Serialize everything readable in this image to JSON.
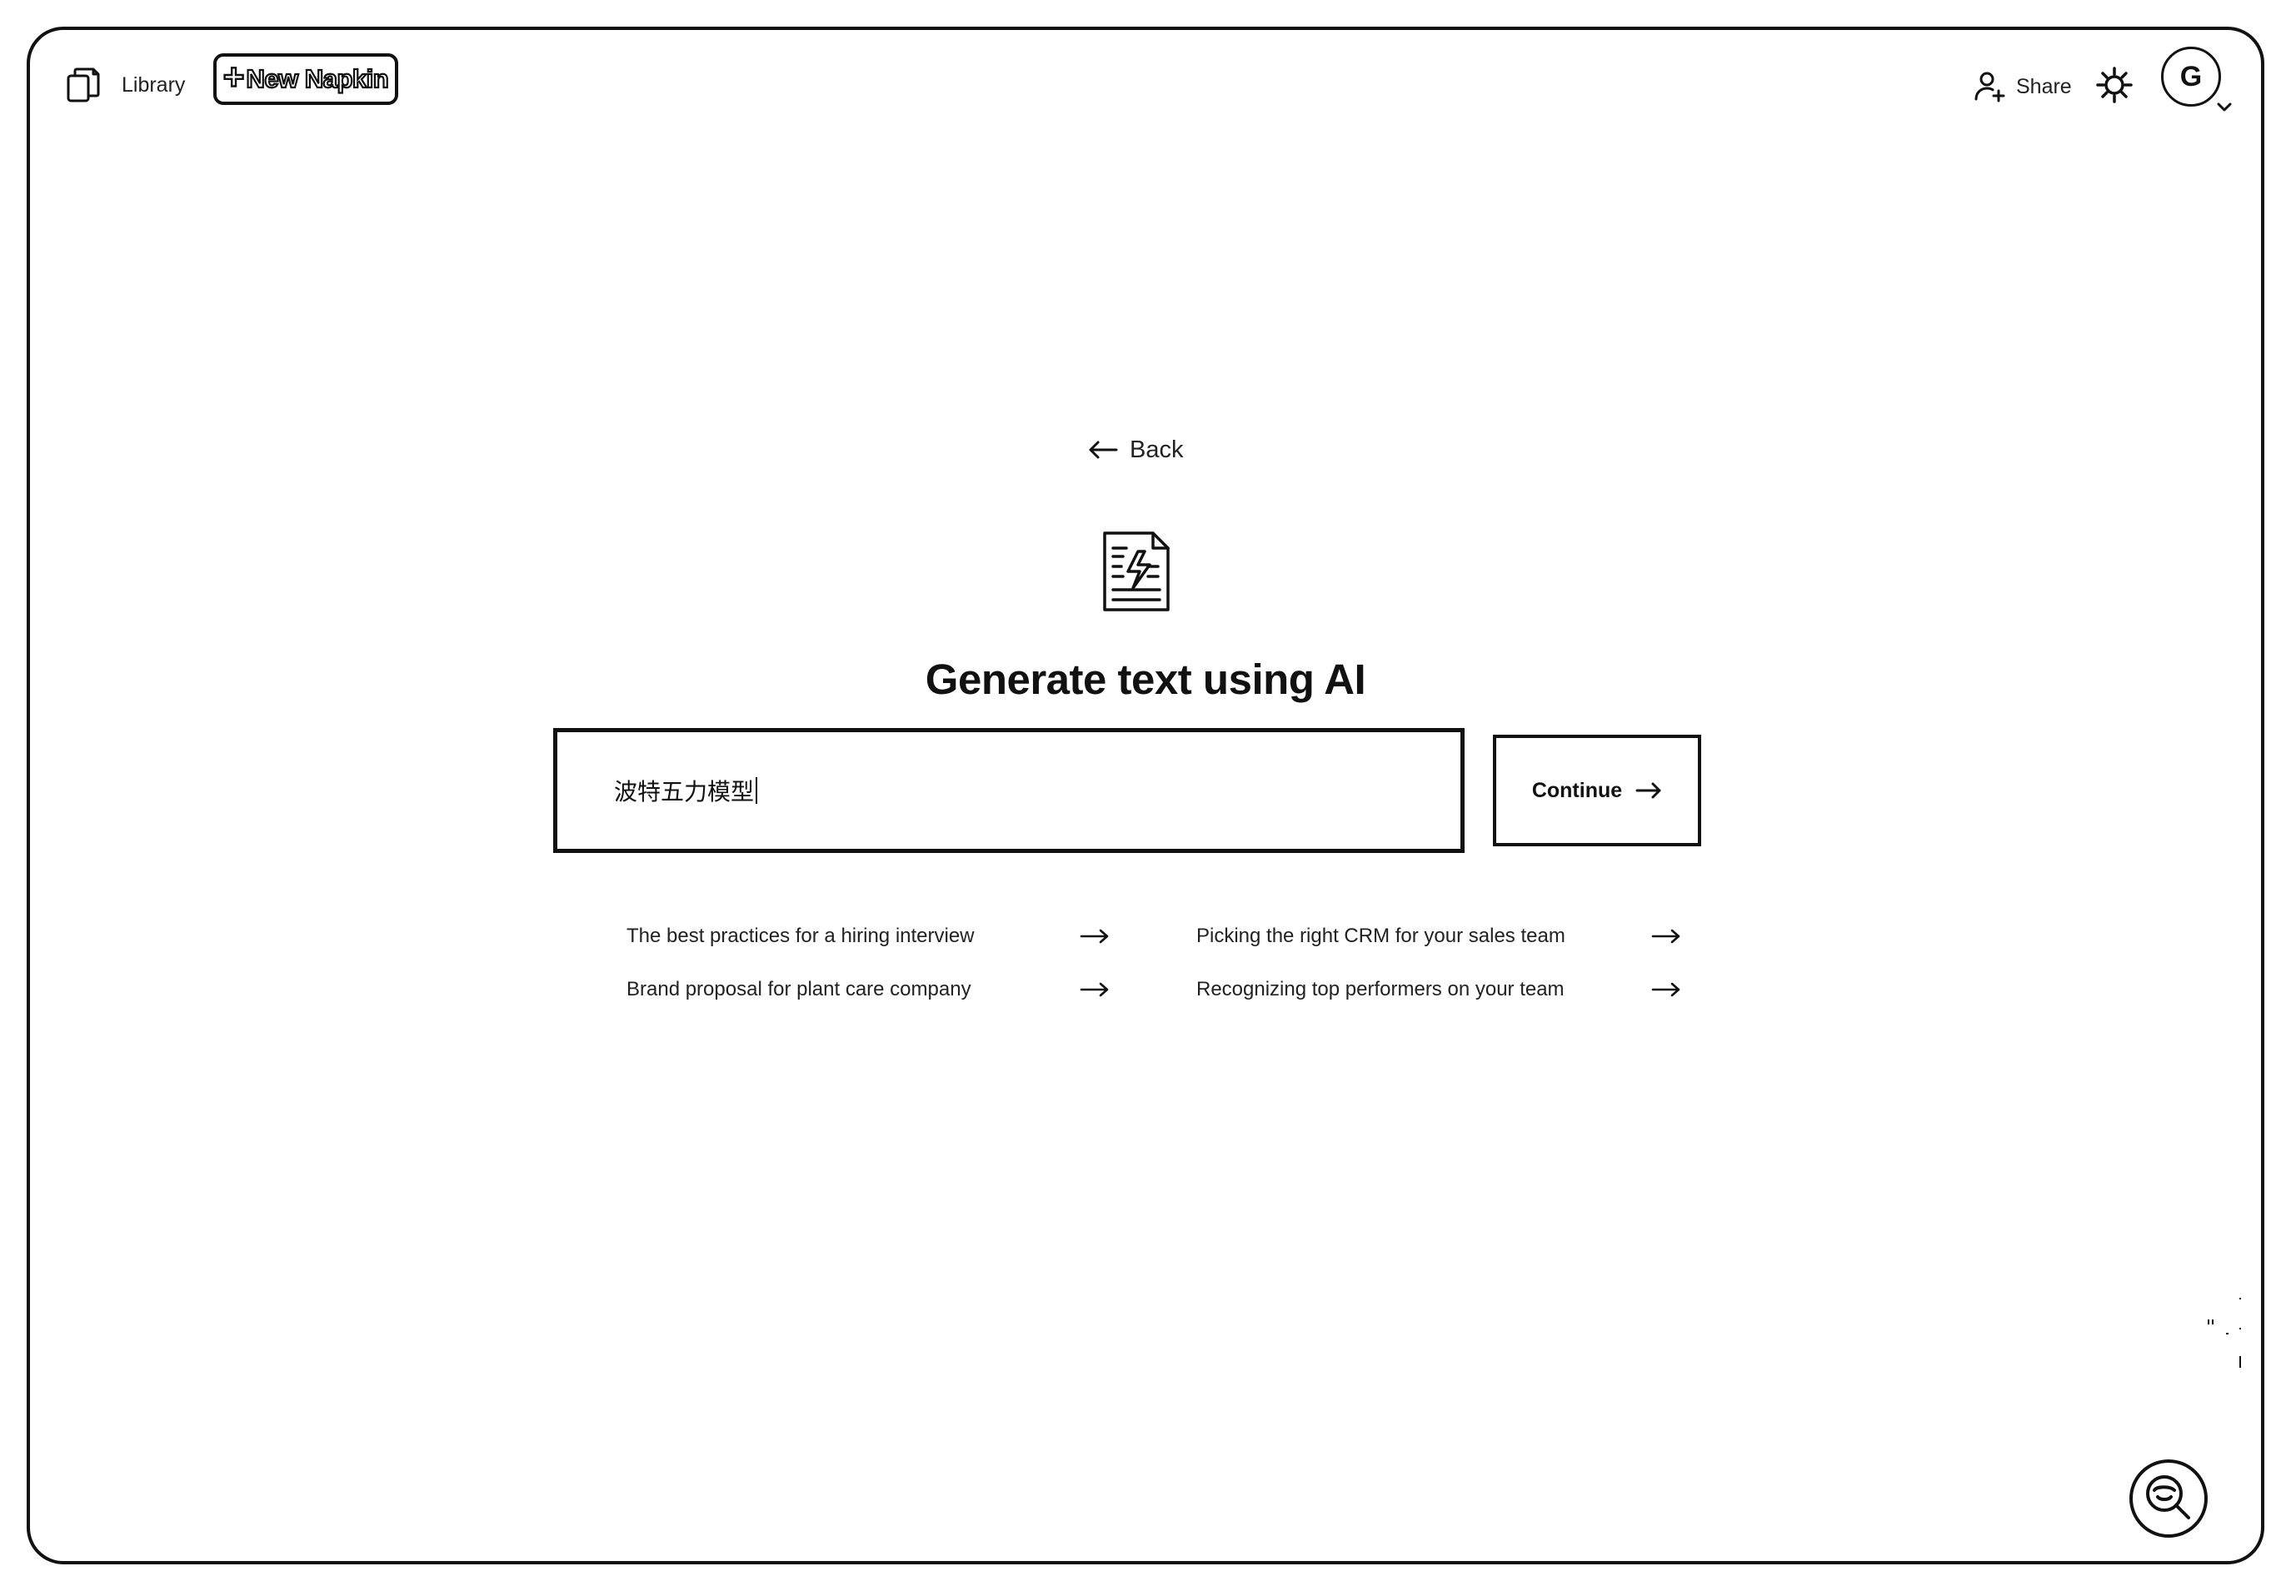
{
  "topbar": {
    "library_label": "Library",
    "new_napkin_label": "New Napkin",
    "share_label": "Share",
    "avatar_initial": "G"
  },
  "main": {
    "back_label": "Back",
    "title": "Generate text using AI",
    "input_value": "波特五力模型",
    "continue_label": "Continue",
    "suggestions": [
      "The best practices for a hiring interview",
      "Picking the right CRM for your sales team",
      "Brand proposal for plant care company",
      "Recognizing top performers on your team"
    ]
  },
  "icons": {
    "library": "library-icon",
    "share": "add-user-icon",
    "settings": "gear-icon",
    "doc": "document-lightning-icon",
    "fab": "search-help-icon"
  },
  "colors": {
    "ink": "#111111",
    "background": "#ffffff"
  }
}
